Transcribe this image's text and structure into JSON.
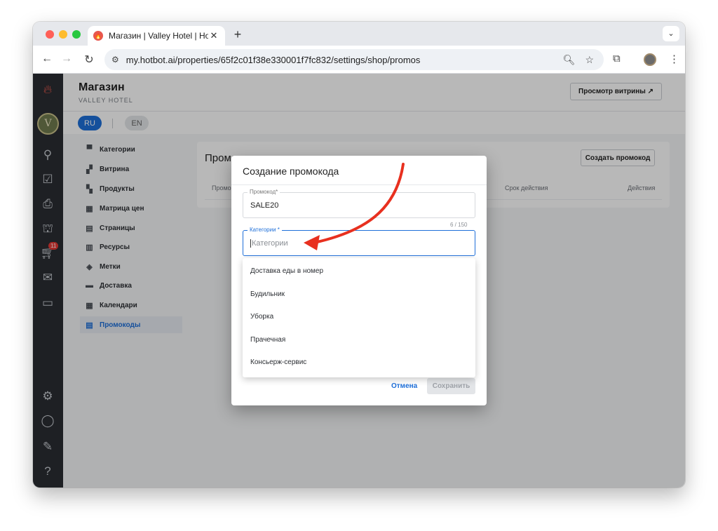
{
  "browser": {
    "tab_title": "Магазин | Valley Hotel | Hotbot",
    "url": "my.hotbot.ai/properties/65f2c01f38e330001f7fc832/settings/shop/promos"
  },
  "header": {
    "title": "Магазин",
    "subtitle": "VALLEY HOTEL",
    "preview_label": "Просмотр витрины ↗"
  },
  "languages": {
    "ru": "RU",
    "en": "EN"
  },
  "rail": {
    "cart_badge": "11",
    "avatar_letter": "V"
  },
  "menu": [
    {
      "label": "Категории",
      "icon": "▀"
    },
    {
      "label": "Витрина",
      "icon": "▞"
    },
    {
      "label": "Продукты",
      "icon": "▚"
    },
    {
      "label": "Матрица цен",
      "icon": "▦"
    },
    {
      "label": "Страницы",
      "icon": "▤"
    },
    {
      "label": "Ресурсы",
      "icon": "▥"
    },
    {
      "label": "Метки",
      "icon": "◈"
    },
    {
      "label": "Доставка",
      "icon": "▬"
    },
    {
      "label": "Календари",
      "icon": "▦"
    },
    {
      "label": "Промокоды",
      "icon": "▤"
    }
  ],
  "promos_card": {
    "title": "Промо",
    "create_label": "Создать промокод",
    "columns": [
      "Промо",
      "Срок действия",
      "Действия"
    ]
  },
  "dialog": {
    "title": "Создание промокода",
    "promo_label": "Промокод*",
    "promo_value": "SALE20",
    "counter": "6 / 150",
    "categories_label": "Категории *",
    "categories_placeholder": "Категории",
    "options": [
      "Доставка еды в номер",
      "Будильник",
      "Уборка",
      "Прачечная",
      "Консьерж-сервис"
    ],
    "cancel_label": "Отмена",
    "save_label": "Сохранить"
  }
}
